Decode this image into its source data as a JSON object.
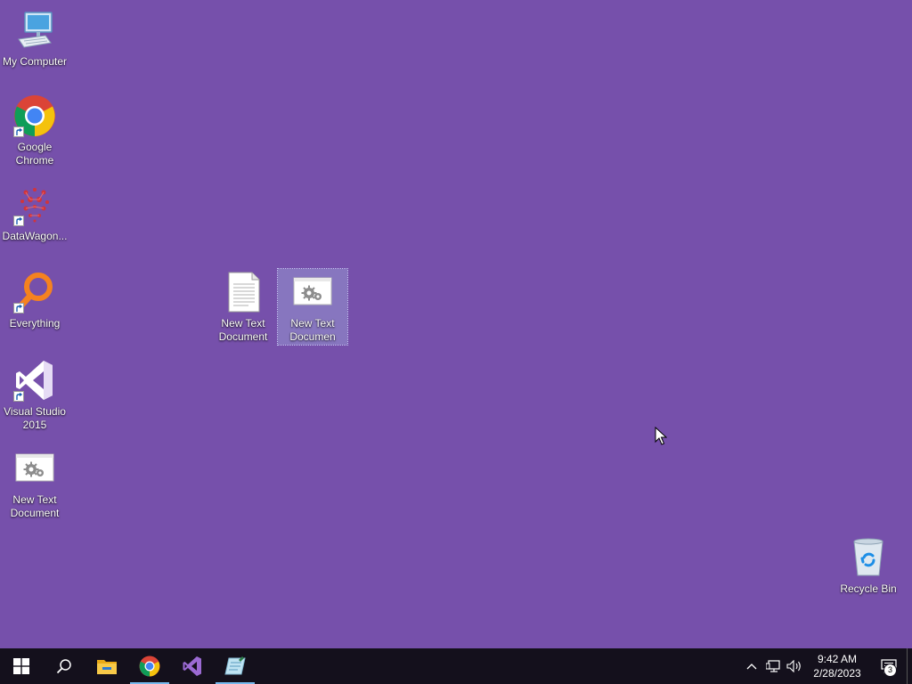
{
  "desktop": {
    "background_color": "#7650ab",
    "icons": [
      {
        "id": "my-computer",
        "label": "My Computer",
        "icon": "computer-icon",
        "shortcut": false
      },
      {
        "id": "google-chrome",
        "label": "Google Chrome",
        "icon": "chrome-icon",
        "shortcut": true
      },
      {
        "id": "datawagon",
        "label": "DataWagon...",
        "icon": "datawagon-icon",
        "shortcut": true
      },
      {
        "id": "everything",
        "label": "Everything",
        "icon": "everything-search-icon",
        "shortcut": true
      },
      {
        "id": "visual-studio",
        "label": "Visual Studio 2015",
        "icon": "visual-studio-icon",
        "shortcut": true
      },
      {
        "id": "new-text-doc-left",
        "label": "New Text Document",
        "icon": "gear-document-icon",
        "shortcut": false
      },
      {
        "id": "new-text-doc-1",
        "label": "New Text Document",
        "icon": "text-document-icon",
        "shortcut": false
      },
      {
        "id": "new-text-doc-2",
        "label": "New Text Documen",
        "icon": "gear-document-icon",
        "shortcut": false,
        "selected": true
      },
      {
        "id": "recycle-bin",
        "label": "Recycle Bin",
        "icon": "recycle-bin-icon",
        "shortcut": false
      }
    ]
  },
  "taskbar": {
    "buttons": [
      {
        "id": "start",
        "icon": "windows-start-icon"
      },
      {
        "id": "search",
        "icon": "search-icon"
      },
      {
        "id": "file-explorer",
        "icon": "file-explorer-icon"
      },
      {
        "id": "chrome",
        "icon": "chrome-icon",
        "active": true
      },
      {
        "id": "visual-studio",
        "icon": "visual-studio-icon"
      },
      {
        "id": "notepad-app",
        "icon": "notepad-icon",
        "active": true
      }
    ],
    "tray": {
      "icons": [
        "chevron-up-icon",
        "network-icon",
        "volume-icon"
      ],
      "time": "9:42 AM",
      "date": "2/28/2023",
      "notification_count": "3"
    }
  },
  "colors": {
    "taskbar": "#14101c",
    "active_indicator": "#76b9ed",
    "selection": "#aabee6"
  }
}
